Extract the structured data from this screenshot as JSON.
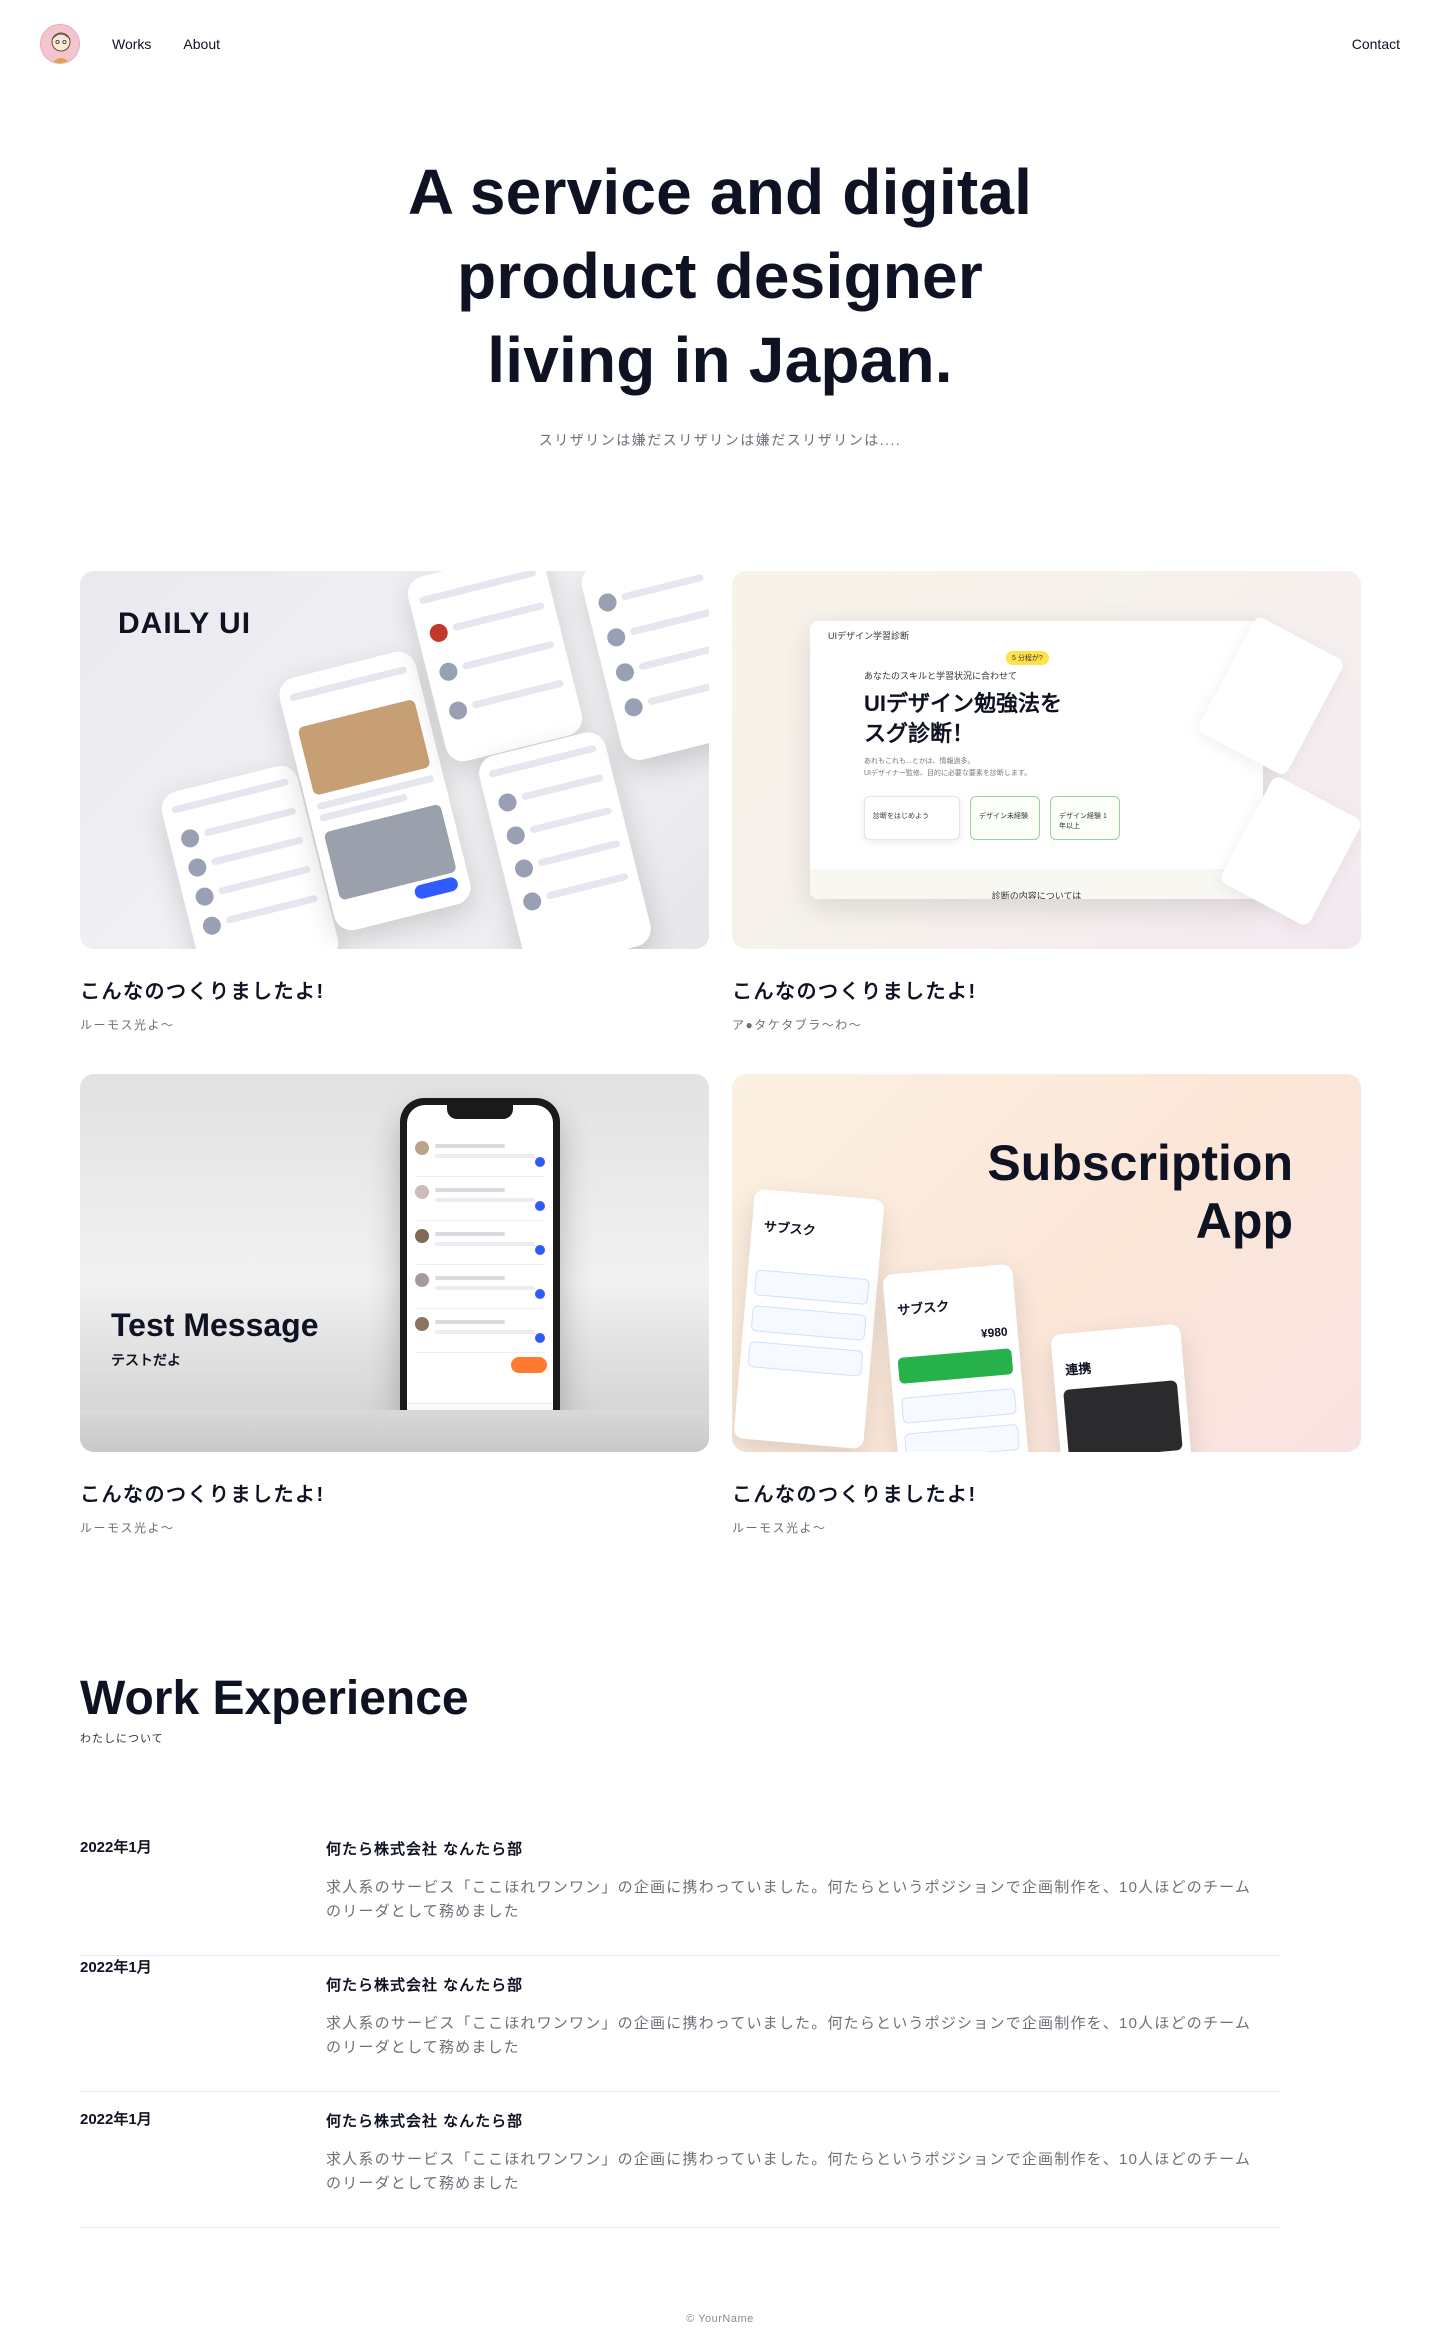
{
  "header": {
    "nav": [
      {
        "label": "Works"
      },
      {
        "label": "About"
      }
    ],
    "contact_label": "Contact"
  },
  "hero": {
    "title_lines": [
      "A service and digital",
      "product designer",
      "living in Japan."
    ],
    "subtitle": "スリザリンは嫌だスリザリンは嫌だスリザリンは...."
  },
  "works": [
    {
      "title": "こんなのつくりましたよ!",
      "subtitle": "ルーモス光よ〜",
      "thumb_label": "DAILY UI"
    },
    {
      "title": "こんなのつくりましたよ!",
      "subtitle": "ア●タケタブラ〜わ〜",
      "thumb_label": "UIデザイン勉強法を スグ診断！",
      "thumb_texts": {
        "head": "UIデザイン学習診断",
        "badge": "5 分程が?",
        "lead": "あなたのスキルと学習状況に合わせて",
        "big_line1": "UIデザイン勉強法を",
        "big_line2": "スグ診断！",
        "small_line1": "あれもこれも...とかは、情報過多。",
        "small_line2": "UIデザイナー監修、目的に必要な要素を診断します。",
        "box1": "診断をはじめよう",
        "box2": "デザイン未経験",
        "box3": "デザイン経験 1年以上",
        "foot": "診断の内容については"
      }
    },
    {
      "title": "こんなのつくりましたよ!",
      "subtitle": "ルーモス光よ〜",
      "thumb_label": "Test Message",
      "thumb_sublabel": "テストだよ"
    },
    {
      "title": "こんなのつくりましたよ!",
      "subtitle": "ルーモス光よ〜",
      "thumb_label_line1": "Subscription",
      "thumb_label_line2": "App",
      "thumb_texts": {
        "sub_title": "サブスク",
        "renkei": "連携",
        "price": "¥980"
      }
    }
  ],
  "experience": {
    "title": "Work Experience",
    "subtitle": "わたしについて",
    "items": [
      {
        "date": "2022年1月",
        "company": "何たら株式会社 なんたら部",
        "description": "求人系のサービス「ここほれワンワン」の企画に携わっていました。何たらというポジションで企画制作を、10人ほどのチームのリーダとして務めました"
      },
      {
        "date": "2022年1月",
        "company": "何たら株式会社 なんたら部",
        "description": "求人系のサービス「ここほれワンワン」の企画に携わっていました。何たらというポジションで企画制作を、10人ほどのチームのリーダとして務めました"
      },
      {
        "date": "2022年1月",
        "company": "何たら株式会社 なんたら部",
        "description": "求人系のサービス「ここほれワンワン」の企画に携わっていました。何たらというポジションで企画制作を、10人ほどのチームのリーダとして務めました"
      }
    ]
  },
  "footer": {
    "copyright": "© YourName"
  },
  "colors": {
    "text": "#0f1222",
    "muted": "#6f6f78",
    "accent_blue": "#2f5bff",
    "accent_orange": "#ff7a2f"
  }
}
